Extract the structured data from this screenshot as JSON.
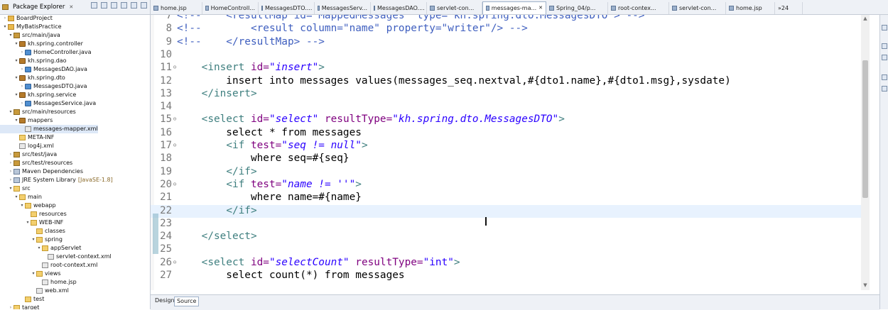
{
  "explorer": {
    "title": "Package Explorer",
    "close": "✕",
    "items": [
      {
        "label": "BoardProject",
        "icon": "project-icon"
      },
      {
        "label": "MyBatisPractice",
        "icon": "project-icon"
      },
      {
        "label": "src/main/java",
        "icon": "source-folder-icon"
      },
      {
        "label": "kh.spring.controller",
        "icon": "package-icon"
      },
      {
        "label": "HomeController.java",
        "icon": "java-file-icon"
      },
      {
        "label": "kh.spring.dao",
        "icon": "package-icon"
      },
      {
        "label": "MessagesDAO.java",
        "icon": "java-file-icon"
      },
      {
        "label": "kh.spring.dto",
        "icon": "package-icon"
      },
      {
        "label": "MessagesDTO.java",
        "icon": "java-file-icon"
      },
      {
        "label": "kh.spring.service",
        "icon": "package-icon"
      },
      {
        "label": "MessagesService.java",
        "icon": "java-file-icon"
      },
      {
        "label": "src/main/resources",
        "icon": "source-folder-icon"
      },
      {
        "label": "mappers",
        "icon": "package-icon"
      },
      {
        "label": "messages-mapper.xml",
        "icon": "xml-file-icon"
      },
      {
        "label": "META-INF",
        "icon": "folder-icon"
      },
      {
        "label": "log4j.xml",
        "icon": "xml-file-icon"
      },
      {
        "label": "src/test/java",
        "icon": "source-folder-icon"
      },
      {
        "label": "src/test/resources",
        "icon": "source-folder-icon"
      },
      {
        "label": "Maven Dependencies",
        "icon": "library-icon"
      },
      {
        "label": "JRE System Library",
        "extra": "[JavaSE-1.8]",
        "icon": "library-icon"
      },
      {
        "label": "src",
        "icon": "folder-icon"
      },
      {
        "label": "main",
        "icon": "folder-icon"
      },
      {
        "label": "webapp",
        "icon": "folder-icon"
      },
      {
        "label": "resources",
        "icon": "folder-icon"
      },
      {
        "label": "WEB-INF",
        "icon": "folder-icon"
      },
      {
        "label": "classes",
        "icon": "folder-icon"
      },
      {
        "label": "spring",
        "icon": "folder-icon"
      },
      {
        "label": "appServlet",
        "icon": "folder-icon"
      },
      {
        "label": "servlet-context.xml",
        "icon": "xml-file-icon"
      },
      {
        "label": "root-context.xml",
        "icon": "xml-file-icon"
      },
      {
        "label": "views",
        "icon": "folder-icon"
      },
      {
        "label": "home.jsp",
        "icon": "jsp-file-icon"
      },
      {
        "label": "web.xml",
        "icon": "xml-file-icon"
      },
      {
        "label": "test",
        "icon": "folder-icon"
      },
      {
        "label": "target",
        "icon": "folder-icon"
      }
    ]
  },
  "tabs": [
    {
      "label": "home.jsp"
    },
    {
      "label": "HomeControll..."
    },
    {
      "label": "MessagesDTO...."
    },
    {
      "label": "MessagesServ..."
    },
    {
      "label": "MessagesDAO...."
    },
    {
      "label": "servlet-con..."
    },
    {
      "label": "messages-ma...",
      "close": "✕"
    },
    {
      "label": "Spring_04/p..."
    },
    {
      "label": "root-contex..."
    },
    {
      "label": "servlet-con..."
    },
    {
      "label": "home.jsp"
    },
    {
      "label": "»24"
    }
  ],
  "editor": {
    "lines": [
      {
        "n": "7",
        "fold": "",
        "segs": [
          [
            "c",
            "<!--    <resultMap id=\"MappedMessages\" type=\"kh.spring.dto.MessagesDTO\"> -->"
          ]
        ]
      },
      {
        "n": "8",
        "fold": "",
        "segs": [
          [
            "c",
            "<!--        <result column=\"name\" property=\"writer\"/> -->"
          ]
        ]
      },
      {
        "n": "9",
        "fold": "",
        "segs": [
          [
            "c",
            "<!--    </resultMap> -->"
          ]
        ]
      },
      {
        "n": "10",
        "fold": "",
        "segs": []
      },
      {
        "n": "11",
        "fold": "⊖",
        "segs": [
          [
            "p",
            "    "
          ],
          [
            "t",
            "<insert "
          ],
          [
            "a",
            "id="
          ],
          [
            "iv",
            "\"insert\""
          ],
          [
            "t",
            ">"
          ]
        ]
      },
      {
        "n": "12",
        "fold": "",
        "segs": [
          [
            "p",
            "        insert into messages values(messages_seq.nextval,#{dto1.name},#{dto1.msg},sysdate)"
          ]
        ]
      },
      {
        "n": "13",
        "fold": "",
        "segs": [
          [
            "p",
            "    "
          ],
          [
            "t",
            "</insert>"
          ]
        ]
      },
      {
        "n": "14",
        "fold": "",
        "segs": []
      },
      {
        "n": "15",
        "fold": "⊖",
        "segs": [
          [
            "p",
            "    "
          ],
          [
            "t",
            "<select "
          ],
          [
            "a",
            "id="
          ],
          [
            "iv",
            "\"select\""
          ],
          [
            "p",
            " "
          ],
          [
            "a",
            "resultType="
          ],
          [
            "iv",
            "\"kh.spring.dto.MessagesDTO\""
          ],
          [
            "t",
            ">"
          ]
        ]
      },
      {
        "n": "16",
        "fold": "",
        "segs": [
          [
            "p",
            "        select * from messages"
          ]
        ]
      },
      {
        "n": "17",
        "fold": "⊖",
        "segs": [
          [
            "p",
            "        "
          ],
          [
            "t",
            "<if "
          ],
          [
            "a",
            "test="
          ],
          [
            "iv",
            "\"seq != null\""
          ],
          [
            "t",
            ">"
          ]
        ]
      },
      {
        "n": "18",
        "fold": "",
        "segs": [
          [
            "p",
            "            where seq=#{seq}"
          ]
        ]
      },
      {
        "n": "19",
        "fold": "",
        "segs": [
          [
            "p",
            "        "
          ],
          [
            "t",
            "</if>"
          ]
        ]
      },
      {
        "n": "20",
        "fold": "⊖",
        "segs": [
          [
            "p",
            "        "
          ],
          [
            "t",
            "<if "
          ],
          [
            "a",
            "test="
          ],
          [
            "iv",
            "\"name != ''\""
          ],
          [
            "t",
            ">"
          ]
        ]
      },
      {
        "n": "21",
        "fold": "",
        "segs": [
          [
            "p",
            "            where name=#{name}"
          ]
        ]
      },
      {
        "n": "22",
        "fold": "",
        "segs": [
          [
            "p",
            "        "
          ],
          [
            "t",
            "</if>"
          ]
        ],
        "current": true
      },
      {
        "n": "23",
        "fold": "",
        "segs": []
      },
      {
        "n": "24",
        "fold": "",
        "segs": [
          [
            "p",
            "    "
          ],
          [
            "t",
            "</select>"
          ]
        ]
      },
      {
        "n": "25",
        "fold": "",
        "segs": []
      },
      {
        "n": "26",
        "fold": "⊖",
        "segs": [
          [
            "p",
            "    "
          ],
          [
            "t",
            "<select "
          ],
          [
            "a",
            "id="
          ],
          [
            "iv",
            "\"selectCount\""
          ],
          [
            "p",
            " "
          ],
          [
            "a",
            "resultType="
          ],
          [
            "v",
            "\"int\""
          ],
          [
            "t",
            ">"
          ]
        ]
      },
      {
        "n": "27",
        "fold": "",
        "segs": [
          [
            "p",
            "        select count(*) from messages"
          ]
        ]
      }
    ]
  },
  "bottom_tabs": {
    "design": "Design",
    "source": "Source"
  },
  "scroll": {
    "up": "▲",
    "down": "▼"
  },
  "colors": {
    "comment": "#3f5fbf",
    "tag": "#3f7f7f",
    "attribute": "#7f007f",
    "value": "#2a00ff",
    "current_line": "#e8f2fe",
    "change_marker": "#7fb0c2"
  }
}
